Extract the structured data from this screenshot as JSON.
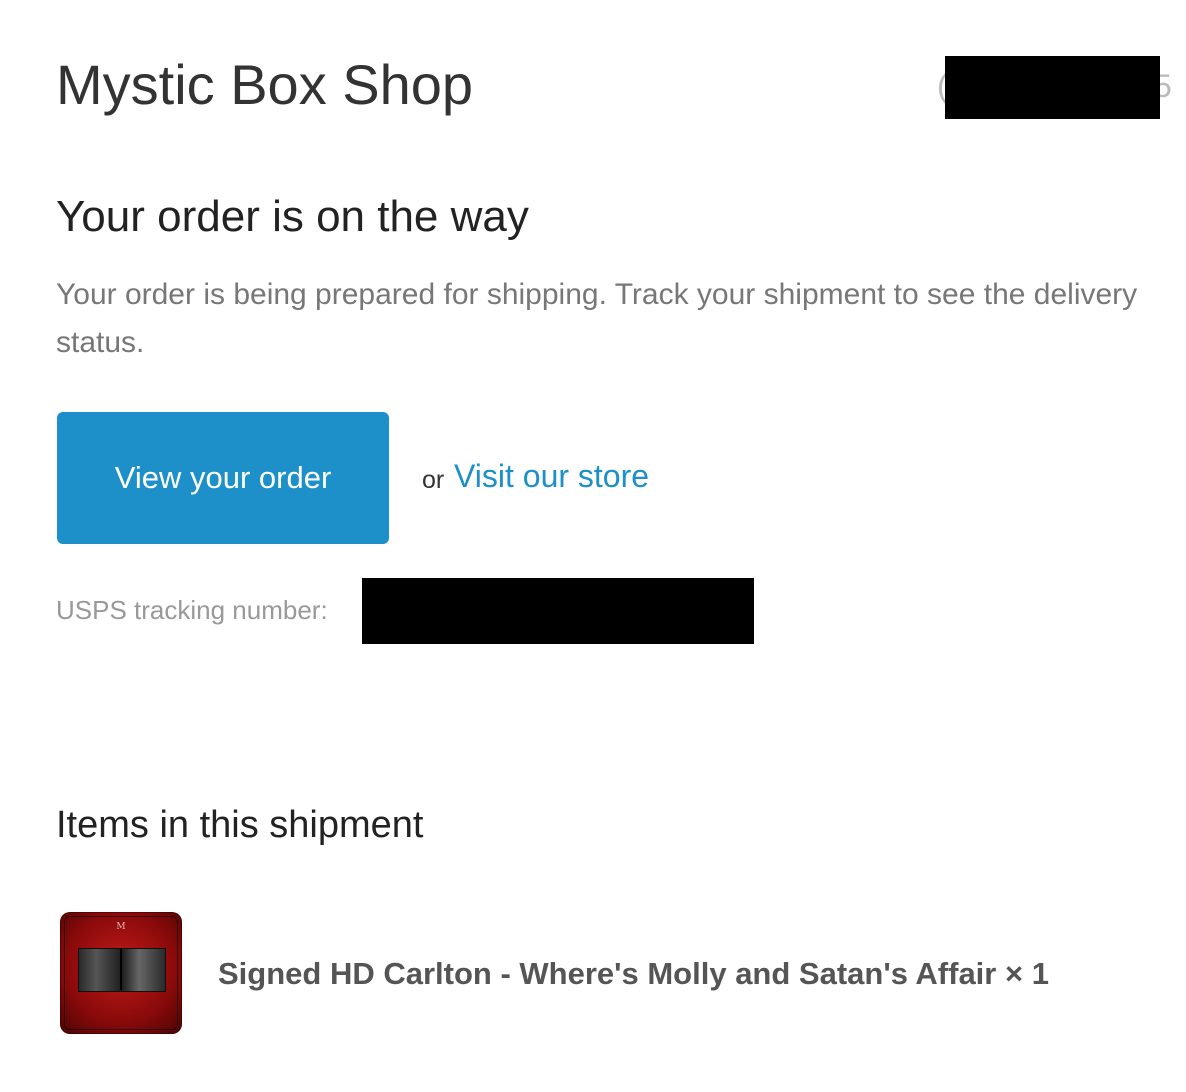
{
  "header": {
    "shop_name": "Mystic Box Shop",
    "order_number_prefix_fragment": "(",
    "order_number_suffix_fragment": "5"
  },
  "status": {
    "heading": "Your order is on the way",
    "message": "Your order is being prepared for shipping. Track your shipment to see the delivery status."
  },
  "actions": {
    "view_order_label": "View your order",
    "or_text": "or",
    "visit_store_label": "Visit our store"
  },
  "tracking": {
    "label": "USPS tracking number:"
  },
  "shipment": {
    "heading": "Items in this shipment",
    "items": [
      {
        "title": "Signed HD Carlton - Where's Molly and Satan's Affair × 1"
      }
    ]
  },
  "colors": {
    "accent": "#1d90c9",
    "heading_text": "#222222",
    "muted_text": "#777777"
  }
}
